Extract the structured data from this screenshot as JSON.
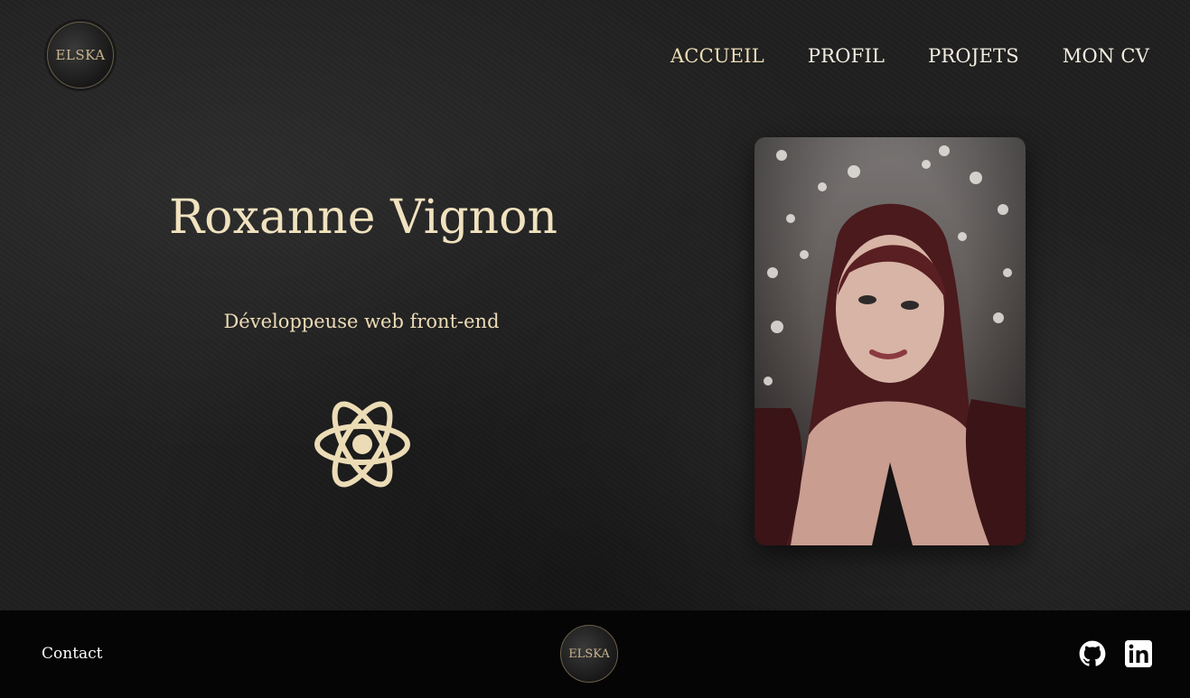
{
  "header": {
    "logo_text": "ELSKA",
    "nav": [
      {
        "label": "ACCUEIL",
        "active": true
      },
      {
        "label": "PROFIL",
        "active": false
      },
      {
        "label": "PROJETS",
        "active": false
      },
      {
        "label": "MON CV",
        "active": false
      }
    ]
  },
  "hero": {
    "name": "Roxanne Vignon",
    "role": "Développeuse web front-end",
    "icon": "react-atom-icon",
    "photo": "portrait-photo"
  },
  "footer": {
    "contact_label": "Contact",
    "logo_text": "ELSKA",
    "social": [
      {
        "icon": "github-icon"
      },
      {
        "icon": "linkedin-icon"
      }
    ]
  },
  "colors": {
    "accent": "#ecdcb6",
    "nav_text": "#f2ede0",
    "background": "#202020",
    "footer_background": "#050505"
  }
}
